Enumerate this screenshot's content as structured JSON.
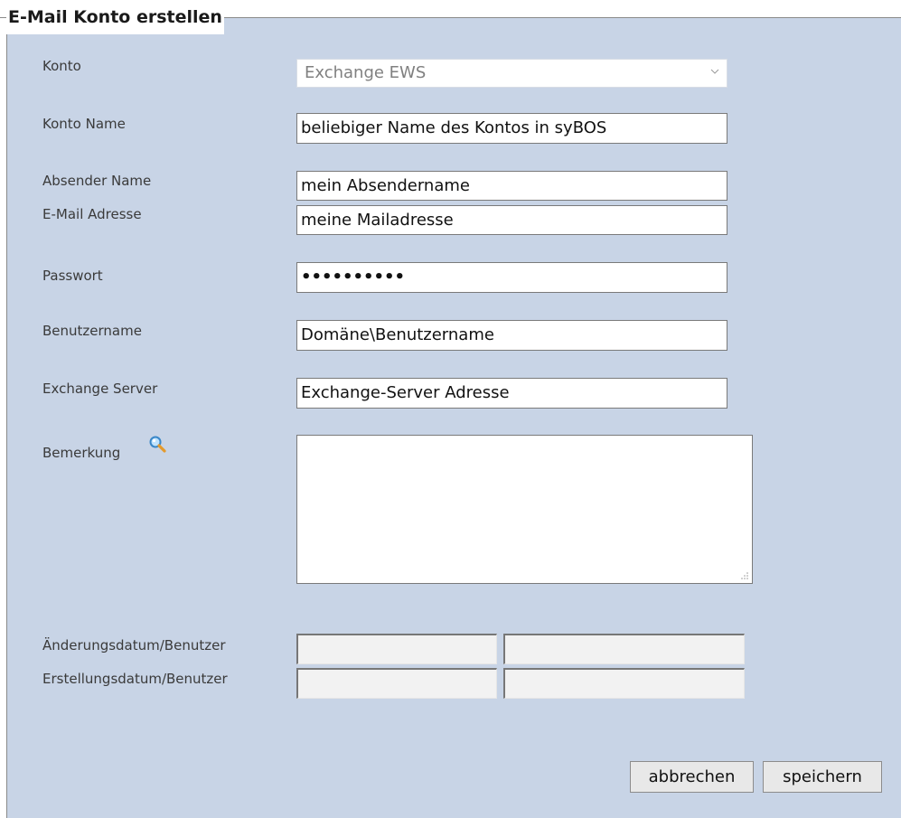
{
  "form": {
    "title": "E-Mail Konto erstellen"
  },
  "fields": {
    "konto": {
      "label": "Konto",
      "value": "Exchange EWS"
    },
    "konto_name": {
      "label": "Konto Name",
      "value": "beliebiger Name des Kontos in syBOS"
    },
    "absender_name": {
      "label": "Absender Name",
      "value": "mein Absendername"
    },
    "email": {
      "label": "E-Mail Adresse",
      "value": "meine Mailadresse"
    },
    "passwort": {
      "label": "Passwort",
      "value": "••••••••••"
    },
    "benutzername": {
      "label": "Benutzername",
      "value": "Domäne\\Benutzername"
    },
    "exchange_server": {
      "label": "Exchange Server",
      "value": "Exchange-Server Adresse"
    },
    "bemerkung": {
      "label": "Bemerkung",
      "value": ""
    },
    "aenderung": {
      "label": "Änderungsdatum/Benutzer",
      "date": "",
      "user": ""
    },
    "erstellung": {
      "label": "Erstellungsdatum/Benutzer",
      "date": "",
      "user": ""
    }
  },
  "buttons": {
    "cancel": "abbrechen",
    "save": "speichern"
  },
  "icons": {
    "bemerkung_zoom": "magnifier-icon",
    "konto_dropdown": "chevron-down-icon",
    "textarea_resize": "resize-grip-icon"
  },
  "colors": {
    "panel_background": "#c8d4e6",
    "field_border": "#7a7a7a",
    "button_background": "#e8e8e8"
  }
}
